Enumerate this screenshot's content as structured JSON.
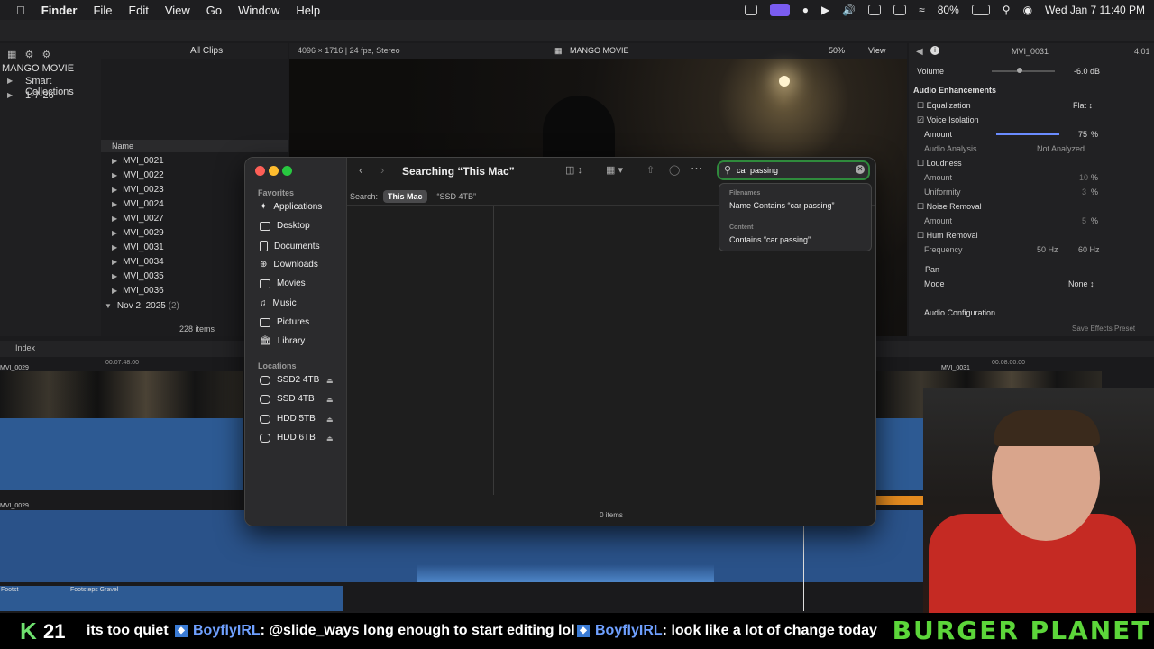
{
  "menubar": {
    "items": [
      "Finder",
      "File",
      "Edit",
      "View",
      "Go",
      "Window",
      "Help"
    ],
    "battery": "80%",
    "datetime": "Wed Jan 7  11:40 PM"
  },
  "fcp": {
    "all_clips": "All Clips",
    "format": "4096 × 1716 | 24 fps, Stereo",
    "project": "MANGO MOVIE",
    "zoom": "50%",
    "view": "View",
    "clip_name": "MVI_0031",
    "duration": "4:01",
    "library": {
      "name": "MANGO MOVIE",
      "items": [
        "Smart Collections",
        "1-7-26"
      ]
    },
    "browser": {
      "name_header": "Name",
      "clips": [
        "MVI_0021",
        "MVI_0022",
        "MVI_0023",
        "MVI_0024",
        "MVI_0027",
        "MVI_0029",
        "MVI_0031",
        "MVI_0034",
        "MVI_0035",
        "MVI_0036"
      ],
      "group_label": "Nov 2, 2025",
      "group_count": "(2)",
      "item_count": "228 items"
    },
    "inspector": {
      "volume_label": "Volume",
      "volume_value": "-6.0 dB",
      "audio_enhancements": "Audio Enhancements",
      "equalization": "Equalization",
      "eq_value": "Flat",
      "voice_isolation": "Voice Isolation",
      "amount": "Amount",
      "vi_amount": "75",
      "audio_analysis": "Audio Analysis",
      "analysis_value": "Not Analyzed",
      "loudness": "Loudness",
      "loud_amount": "10",
      "uniformity": "Uniformity",
      "uniformity_value": "3",
      "noise_removal": "Noise Removal",
      "noise_amount": "5",
      "hum_removal": "Hum Removal",
      "frequency": "Frequency",
      "freq_50": "50 Hz",
      "freq_60": "60 Hz",
      "pan": "Pan",
      "mode": "Mode",
      "mode_value": "None",
      "audio_config": "Audio Configuration",
      "save_preset": "Save Effects Preset",
      "percent": "%"
    },
    "timeline": {
      "index": "Index",
      "tc1": "00:07:48:00",
      "tc2": "00:08:00:00",
      "clip_top_left": "MVI_0029",
      "clip_top_right": "MVI_0031",
      "clip_lower": "MVI_0029",
      "audio1": "Footsteps Gravel",
      "audio0": "Footst"
    }
  },
  "finder": {
    "title": "Searching “This Mac”",
    "search_label": "Search:",
    "scope_this_mac": "This Mac",
    "scope_ssd": "“SSD 4TB”",
    "favorites_header": "Favorites",
    "favorites": [
      "Applications",
      "Desktop",
      "Documents",
      "Downloads",
      "Movies",
      "Music",
      "Pictures",
      "Library"
    ],
    "locations_header": "Locations",
    "locations": [
      "SSD2 4TB",
      "SSD 4TB",
      "HDD 5TB",
      "HDD 6TB"
    ],
    "search_value": "car passing",
    "suggestions": {
      "filenames_header": "Filenames",
      "filename_item": "Name Contains “car passing”",
      "content_header": "Content",
      "content_item": "Contains “car passing”"
    },
    "status": "0 items"
  },
  "ticker": {
    "k_icon": "K",
    "count": "21",
    "msg1": "its too quiet",
    "user1": "BoyflyIRL",
    "msg2": ": @slide_ways long enough to start editing lol",
    "user2": "BoyflyIRL",
    "msg3": ": look like a lot of change today",
    "brand": "BURGER PLANET"
  }
}
